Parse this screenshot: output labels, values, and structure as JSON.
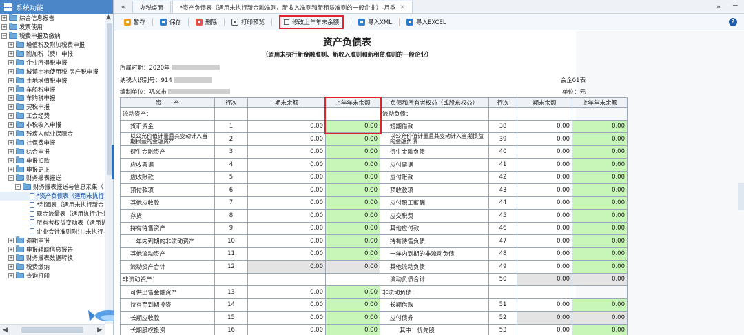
{
  "sidebar": {
    "title": "系统功能",
    "items": [
      {
        "label": "综合信息报告",
        "level": 0,
        "toggle": "+",
        "icon": "folder"
      },
      {
        "label": "发票使用",
        "level": 0,
        "toggle": "+",
        "icon": "folder"
      },
      {
        "label": "税费申报及缴纳",
        "level": 0,
        "toggle": "−",
        "icon": "folder"
      },
      {
        "label": "增值税及附加税费申报",
        "level": 1,
        "toggle": "+",
        "icon": "folder"
      },
      {
        "label": "附加税（费）申报",
        "level": 1,
        "toggle": "+",
        "icon": "folder"
      },
      {
        "label": "企业所得税申报",
        "level": 1,
        "toggle": "+",
        "icon": "folder"
      },
      {
        "label": "城镇土地使用税 房产税申报",
        "level": 1,
        "toggle": "+",
        "icon": "folder"
      },
      {
        "label": "土地增值税申报",
        "level": 1,
        "toggle": "+",
        "icon": "folder"
      },
      {
        "label": "车船税申报",
        "level": 1,
        "toggle": "+",
        "icon": "folder"
      },
      {
        "label": "车购税申报",
        "level": 1,
        "toggle": "+",
        "icon": "folder"
      },
      {
        "label": "契税申报",
        "level": 1,
        "toggle": "+",
        "icon": "folder"
      },
      {
        "label": "工会经费",
        "level": 1,
        "toggle": "+",
        "icon": "folder"
      },
      {
        "label": "非税收入申报",
        "level": 1,
        "toggle": "+",
        "icon": "folder"
      },
      {
        "label": "残疾人就业保障金",
        "level": 1,
        "toggle": "+",
        "icon": "folder"
      },
      {
        "label": "社保费申报",
        "level": 1,
        "toggle": "+",
        "icon": "folder"
      },
      {
        "label": "综合申报",
        "level": 1,
        "toggle": "+",
        "icon": "folder"
      },
      {
        "label": "申报扣款",
        "level": 1,
        "toggle": "+",
        "icon": "folder"
      },
      {
        "label": "申报更正",
        "level": 1,
        "toggle": "+",
        "icon": "folder"
      },
      {
        "label": "财务报表报送",
        "level": 1,
        "toggle": "−",
        "icon": "folder"
      },
      {
        "label": "财务报表报送与信息采集（",
        "level": 2,
        "toggle": "−",
        "icon": "folder"
      },
      {
        "label": "*资产负债表（适用未执行",
        "level": 3,
        "toggle": "",
        "icon": "doc",
        "selected": true
      },
      {
        "label": "*利润表（适用未执行新金",
        "level": 3,
        "toggle": "",
        "icon": "doc"
      },
      {
        "label": "现金流量表（适用执行企业",
        "level": 3,
        "toggle": "",
        "icon": "doc"
      },
      {
        "label": "所有者权益变动表（适用执",
        "level": 3,
        "toggle": "",
        "icon": "doc"
      },
      {
        "label": "企业会计准则附注-未执行-",
        "level": 3,
        "toggle": "",
        "icon": "doc"
      },
      {
        "label": "逾期申报",
        "level": 1,
        "toggle": "+",
        "icon": "folder"
      },
      {
        "label": "申报辅助信息报告",
        "level": 1,
        "toggle": "+",
        "icon": "folder"
      },
      {
        "label": "财务报表数据转换",
        "level": 1,
        "toggle": "+",
        "icon": "folder"
      },
      {
        "label": "税费缴纳",
        "level": 1,
        "toggle": "+",
        "icon": "folder"
      },
      {
        "label": "查询打印",
        "level": 1,
        "toggle": "+",
        "icon": "folder"
      }
    ]
  },
  "tabs": [
    {
      "label": "办税桌面",
      "closable": false
    },
    {
      "label": "*资产负债表（适用未执行新金融准则、新收入准则和新租赁准则的一般企业）-月季",
      "closable": true,
      "active": true
    }
  ],
  "toolbar": {
    "save_draft": "暂存",
    "save": "保存",
    "delete": "删除",
    "print_preview": "打印预览",
    "modify_prev_year": "修改上年年末余额",
    "import_xml": "导入XML",
    "import_excel": "导入EXCEL"
  },
  "document": {
    "title": "资产负债表",
    "subtitle": "（适用未执行新金融准则、新收入准则和新租赁准则的一般企业）",
    "period_label": "所属时期：2020年",
    "taxpayer_label": "纳税人识别号：914",
    "unit_label": "编制单位：巩义市",
    "form_code": "会企01表",
    "currency_unit": "单位：元"
  },
  "table": {
    "headers": [
      "资　　产",
      "行次",
      "期末余额",
      "上年年末余额",
      "负债和所有者权益（或股东权益）",
      "行次",
      "期末余额",
      "上年年末余额"
    ],
    "rows": [
      {
        "l": "流动资产：",
        "ln": "",
        "le": "",
        "lp": "",
        "r": "流动负债：",
        "rn": "",
        "re": "",
        "rp": "",
        "lsec": true,
        "rsec": true
      },
      {
        "l": "货币资金",
        "ln": "1",
        "le": "0.00",
        "lp": "0.00",
        "r": "短期借款",
        "rn": "38",
        "re": "0.00",
        "rp": "0.00"
      },
      {
        "l": "以公允价值计量且其变动计入当期损益的金融资产",
        "ln": "2",
        "le": "0.00",
        "lp": "0.00",
        "r": "以公允价值计量且其变动计入当期损益的金融负债",
        "rn": "39",
        "re": "0.00",
        "rp": "0.00",
        "wrap": true
      },
      {
        "l": "衍生金融资产",
        "ln": "3",
        "le": "0.00",
        "lp": "0.00",
        "r": "衍生金融负债",
        "rn": "40",
        "re": "0.00",
        "rp": "0.00"
      },
      {
        "l": "应收票据",
        "ln": "4",
        "le": "0.00",
        "lp": "0.00",
        "r": "应付票据",
        "rn": "41",
        "re": "0.00",
        "rp": "0.00"
      },
      {
        "l": "应收账款",
        "ln": "5",
        "le": "0.00",
        "lp": "0.00",
        "r": "应付账款",
        "rn": "42",
        "re": "0.00",
        "rp": "0.00"
      },
      {
        "l": "预付款项",
        "ln": "6",
        "le": "0.00",
        "lp": "0.00",
        "r": "预收款项",
        "rn": "43",
        "re": "0.00",
        "rp": "0.00"
      },
      {
        "l": "其他应收款",
        "ln": "7",
        "le": "0.00",
        "lp": "0.00",
        "r": "应付职工薪酬",
        "rn": "44",
        "re": "0.00",
        "rp": "0.00"
      },
      {
        "l": "存货",
        "ln": "8",
        "le": "0.00",
        "lp": "0.00",
        "r": "应交税费",
        "rn": "45",
        "re": "0.00",
        "rp": "0.00"
      },
      {
        "l": "持有待售资产",
        "ln": "9",
        "le": "0.00",
        "lp": "0.00",
        "r": "其他应付款",
        "rn": "46",
        "re": "0.00",
        "rp": "0.00"
      },
      {
        "l": "一年内到期的非流动资产",
        "ln": "10",
        "le": "0.00",
        "lp": "0.00",
        "r": "持有待售负债",
        "rn": "47",
        "re": "0.00",
        "rp": "0.00"
      },
      {
        "l": "其他流动资产",
        "ln": "11",
        "le": "0.00",
        "lp": "0.00",
        "r": "一年内到期的非流动负债",
        "rn": "48",
        "re": "0.00",
        "rp": "0.00"
      },
      {
        "l": "流动资产合计",
        "ln": "12",
        "le": "0.00",
        "lp": "0.00",
        "r": "其他流动负债",
        "rn": "49",
        "re": "0.00",
        "rp": "0.00",
        "ltotal": true
      },
      {
        "l": "非流动资产：",
        "ln": "",
        "le": "",
        "lp": "",
        "r": "流动负债合计",
        "rn": "50",
        "re": "0.00",
        "rp": "0.00",
        "lsec": true,
        "rtotal": true
      },
      {
        "l": "可供出售金融资产",
        "ln": "13",
        "le": "0.00",
        "lp": "0.00",
        "r": "非流动负债：",
        "rn": "",
        "re": "",
        "rp": "",
        "rsec": true
      },
      {
        "l": "持有至到期投资",
        "ln": "14",
        "le": "0.00",
        "lp": "0.00",
        "r": "长期借款",
        "rn": "51",
        "re": "0.00",
        "rp": "0.00"
      },
      {
        "l": "长期应收款",
        "ln": "15",
        "le": "0.00",
        "lp": "0.00",
        "r": "应付债券",
        "rn": "52",
        "re": "0.00",
        "rp": "0.00",
        "rtotal": true
      },
      {
        "l": "长期股权投资",
        "ln": "16",
        "le": "0.00",
        "lp": "0.00",
        "r": "其中：优先股",
        "rn": "53",
        "re": "0.00",
        "rp": "0.00",
        "rsub": true
      }
    ]
  },
  "colors": {
    "accent": "#4a86c8",
    "highlight": "#e0232d",
    "editable_cell": "#c8f5b8",
    "computed_cell": "#e4e4e4"
  }
}
